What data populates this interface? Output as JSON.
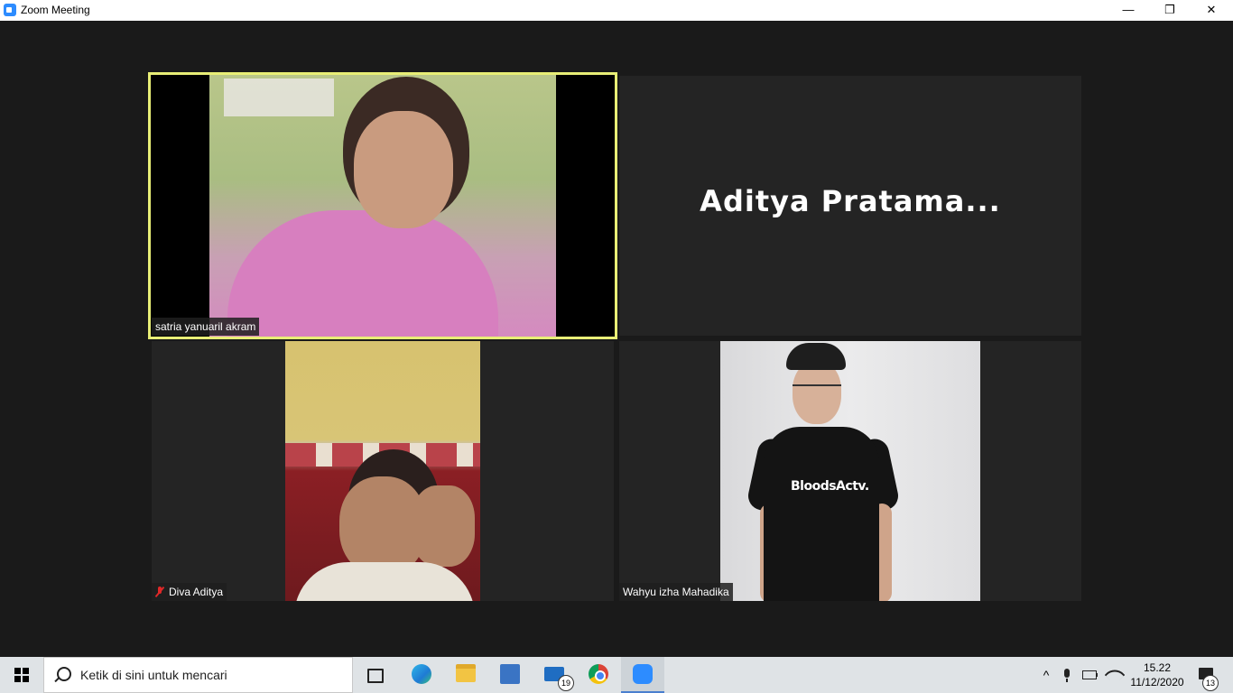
{
  "window": {
    "title": "Zoom Meeting",
    "controls": {
      "minimize": "—",
      "maximize": "❐",
      "close": "✕"
    }
  },
  "meeting": {
    "active_speaker_color": "#e8ee76",
    "participants": [
      {
        "name": "satria yanuaril akram",
        "video": true,
        "muted": false,
        "active_speaker": true
      },
      {
        "name": "Aditya  Pratama...",
        "video": false,
        "muted": false
      },
      {
        "name": "Diva Aditya",
        "video": true,
        "muted": true
      },
      {
        "name": "Wahyu izha Mahadika",
        "video": true,
        "muted": false,
        "shirt_text": "BloodsActv."
      }
    ]
  },
  "taskbar": {
    "search_placeholder": "Ketik di sini untuk mencari",
    "apps": [
      {
        "icon": "task-view-icon"
      },
      {
        "icon": "edge-icon"
      },
      {
        "icon": "file-explorer-icon"
      },
      {
        "icon": "app-icon"
      },
      {
        "icon": "mail-icon",
        "badge": "19"
      },
      {
        "icon": "chrome-icon"
      },
      {
        "icon": "zoom-icon",
        "active": true
      }
    ],
    "tray": {
      "chevron": "^"
    },
    "clock": {
      "time": "15.22",
      "date": "11/12/2020"
    },
    "notifications_badge": "13"
  }
}
